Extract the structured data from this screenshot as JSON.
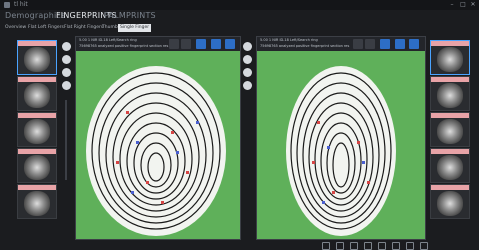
{
  "app": {
    "title": "tl hit"
  },
  "window_controls": [
    "–",
    "□",
    "✕"
  ],
  "topnav": {
    "items": [
      {
        "label": "Demographics",
        "active": false
      },
      {
        "label": "FINGERPRINTS",
        "active": true
      },
      {
        "label": "PALMPRINTS",
        "active": false
      }
    ]
  },
  "subtabs": [
    {
      "label": "Overview",
      "active": false
    },
    {
      "label": "Flat Left Fingers",
      "active": false
    },
    {
      "label": "Flat Right Fingers",
      "active": false
    },
    {
      "label": "Thumbs",
      "active": false
    },
    {
      "label": "Single Finger",
      "active": true
    }
  ],
  "panels": {
    "left": {
      "info_line1": "5.00 1   NIR  ID-18  Left/Search ring",
      "info_line2": "75698765  analyzed  positive  fingerprint  section res"
    },
    "right": {
      "info_line1": "5.00 1   NIR  ID-18  Left/Search ring",
      "info_line2": "75698765  analyzed  positive  fingerprint  section res"
    }
  },
  "colors": {
    "background": "#1b1c1f",
    "canvas_green": "#5fb05a",
    "accent_blue": "#2d6ec6",
    "thumb_tag": "#e8a3a7",
    "selection": "#4aa3ff"
  },
  "icons": {
    "toolbar": [
      "crosshair-icon",
      "circle-icon",
      "target-icon",
      "plus-icon",
      "grid-icon"
    ],
    "vtools": [
      "zoom-icon",
      "contrast-icon",
      "circle-icon",
      "settings-icon"
    ],
    "bottom": [
      "arrow-icon",
      "pointer-icon",
      "grid-icon",
      "edit-icon",
      "layers-icon",
      "gear-icon",
      "image-icon",
      "export-icon"
    ]
  }
}
